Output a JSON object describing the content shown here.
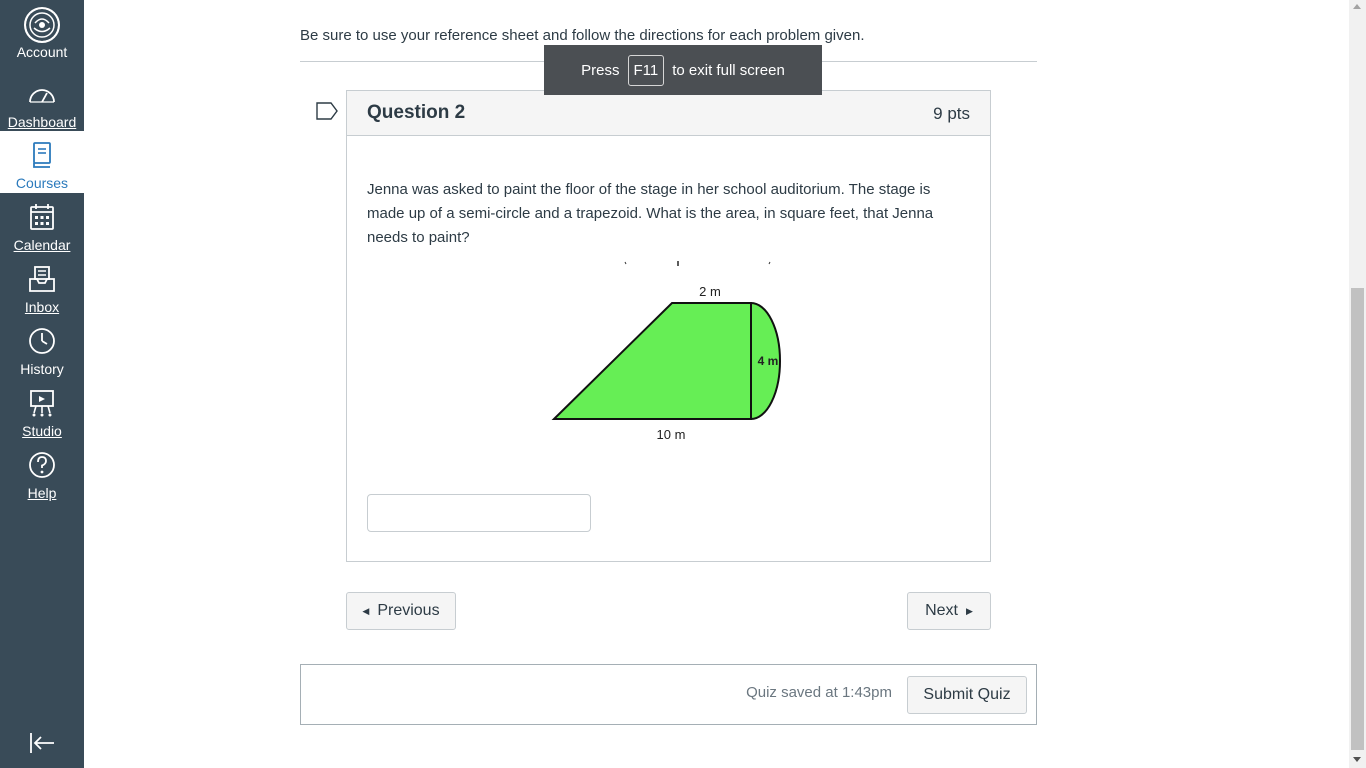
{
  "nav": {
    "account": "Account",
    "dashboard": "Dashboard",
    "courses": "Courses",
    "calendar": "Calendar",
    "inbox": "Inbox",
    "history": "History",
    "studio": "Studio",
    "help": "Help"
  },
  "quiz": {
    "intro": "Be sure to use your reference sheet and follow the directions for each problem given.",
    "fullscreen_press": "Press",
    "fullscreen_key": "F11",
    "fullscreen_exit": "to exit full screen",
    "question": {
      "title": "Question 2",
      "points": "9 pts",
      "text": "Jenna was asked to paint the floor of the stage in her school auditorium.  The stage is made up of a semi-circle and a trapezoid. What is the area, in square feet, that Jenna needs to paint?",
      "figure": {
        "top_label": "2 m",
        "height_label": "4 m",
        "base_label": "10 m",
        "fill_color": "#66ee55"
      },
      "answer_value": ""
    },
    "prev_label": "Previous",
    "next_label": "Next",
    "saved_text": "Quiz saved at 1:43pm",
    "submit_label": "Submit Quiz"
  },
  "colors": {
    "nav_bg": "#394b58",
    "active_link": "#2b7abc"
  }
}
